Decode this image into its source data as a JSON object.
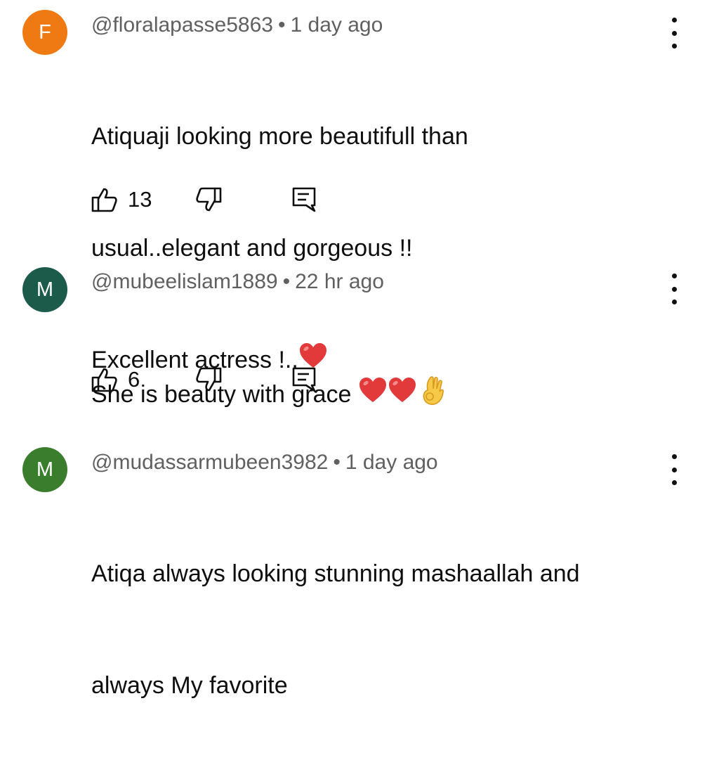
{
  "colors": {
    "avatar_f": "#ef7a14",
    "avatar_m1": "#1c5b49",
    "avatar_m2": "#3a7d2c",
    "heart": "#e23a3a"
  },
  "comments": [
    {
      "avatar_letter": "F",
      "handle": "@floralapasse5863",
      "separator": "•",
      "time": "1 day ago",
      "lines": [
        "Atiquaji looking more beautifull than",
        "usual..elegant and gorgeous !!",
        "Excellent actress !.."
      ],
      "trailing_emoji": [
        "red-heart"
      ],
      "likes": "13"
    },
    {
      "avatar_letter": "M",
      "handle": "@mubeelislam1889",
      "separator": "•",
      "time": "22 hr ago",
      "lines": [
        "She is beauty with grace "
      ],
      "trailing_emoji": [
        "red-heart",
        "red-heart",
        "ok-hand"
      ],
      "likes": "6"
    },
    {
      "avatar_letter": "M",
      "handle": "@mudassarmubeen3982",
      "separator": "•",
      "time": "1 day ago",
      "lines": [
        "Atiqa always looking stunning mashaallah and",
        "always My favorite"
      ],
      "trailing_emoji": [],
      "likes": null
    }
  ]
}
